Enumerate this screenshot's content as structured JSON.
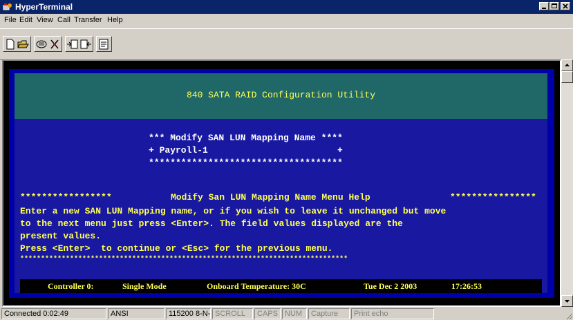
{
  "window": {
    "title": "HyperTerminal"
  },
  "menu": [
    "File",
    "Edit",
    "View",
    "Call",
    "Transfer",
    "Help"
  ],
  "toolbar": {
    "buttons": [
      "new-icon",
      "open-icon",
      "connect-icon",
      "disconnect-icon",
      "send-icon",
      "receive-icon",
      "properties-icon"
    ]
  },
  "terminal": {
    "banner": "840 SATA RAID Configuration Utility",
    "box": [
      "*** Modify SAN LUN Mapping Name ****",
      "+ Payroll-1                        +",
      "************************************"
    ],
    "help_header_left": "*****************",
    "help_header_title": "Modify San LUN Mapping Name Menu Help",
    "help_header_right": "****************",
    "help_lines": [
      "Enter a new SAN LUN Mapping name, or if you wish to leave it unchanged but move",
      "to the next menu just press <Enter>. The field values displayed are the",
      "present values.",
      "Press <Enter>  to continue or <Esc> for the previous menu.",
      "*******************************************************************************"
    ],
    "status": {
      "controller": "Controller 0:",
      "mode": "Single Mode",
      "temperature": "Onboard Temperature: 30C",
      "date": "Tue Dec 2 2003",
      "time": "17:26:53"
    }
  },
  "statusbar": {
    "connected": "Connected 0:02:49",
    "emulation": "ANSI",
    "settings": "115200 8-N-1",
    "scroll": "SCROLL",
    "caps": "CAPS",
    "num": "NUM",
    "capture": "Capture",
    "print_echo": "Print echo"
  }
}
